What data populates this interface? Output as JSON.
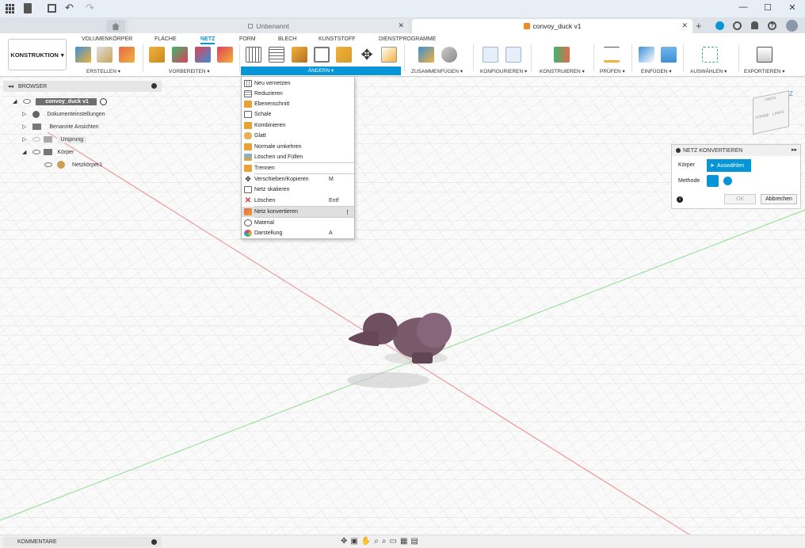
{
  "window": {
    "controls": {
      "minimize": "—",
      "maximize": "☐",
      "close": "✕"
    }
  },
  "tabs": [
    {
      "label": "Unbenannt",
      "close": "✕"
    },
    {
      "label": "convoy_duck v1",
      "close": "✕"
    }
  ],
  "ribbon": {
    "workspace": "KONSTRUKTION",
    "tabs": [
      "VOLUMENKÖRPER",
      "FLÄCHE",
      "NETZ",
      "FORM",
      "BLECH",
      "KUNSTSTOFF",
      "DIENSTPROGRAMME"
    ],
    "active_tab": "NETZ",
    "groups": [
      "ERSTELLEN",
      "VORBEREITEN",
      "ÄNDERN",
      "ZUSAMMENFÜGEN",
      "KONFIGURIEREN",
      "KONSTRUIEREN",
      "PRÜFEN",
      "EINFÜGEN",
      "AUSWÄHLEN",
      "EXPORTIEREN"
    ],
    "accent": "#0696d7"
  },
  "browser": {
    "title": "BROWSER",
    "items": [
      {
        "label": "convoy_duck v1"
      },
      {
        "label": "Dokumenteinstellungen"
      },
      {
        "label": "Benannte Ansichten"
      },
      {
        "label": "Ursprung"
      },
      {
        "label": "Körper"
      },
      {
        "label": "Netzkörper1"
      }
    ]
  },
  "menu": {
    "items": [
      {
        "label": "Neu vernetzen",
        "shortcut": ""
      },
      {
        "label": "Reduzieren",
        "shortcut": ""
      },
      {
        "label": "Ebenenschnitt",
        "shortcut": ""
      },
      {
        "label": "Schale",
        "shortcut": ""
      },
      {
        "label": "Kombinieren",
        "shortcut": ""
      },
      {
        "label": "Glatt",
        "shortcut": ""
      },
      {
        "label": "Normale umkehren",
        "shortcut": ""
      },
      {
        "label": "Löschen und Füllen",
        "shortcut": ""
      },
      {
        "label": "Trennen",
        "shortcut": ""
      },
      {
        "label": "Verschieben/Kopieren",
        "shortcut": "M"
      },
      {
        "label": "Netz skalieren",
        "shortcut": ""
      },
      {
        "label": "Löschen",
        "shortcut": "Entf"
      },
      {
        "label": "Netz konvertieren",
        "shortcut": ""
      },
      {
        "label": "Material",
        "shortcut": ""
      },
      {
        "label": "Darstellung",
        "shortcut": "A"
      }
    ],
    "highlighted": "Netz konvertieren"
  },
  "panel": {
    "title": "NETZ KONVERTIEREN",
    "body_label": "Körper",
    "select_label": "Auswählen",
    "method_label": "Methode",
    "ok": "OK",
    "cancel": "Abbrechen"
  },
  "viewcube": {
    "front": "VORNE",
    "left": "LINKS",
    "top": "OBEN",
    "axis_z": "Z"
  },
  "bottom": {
    "comments": "KOMMENTARE"
  }
}
